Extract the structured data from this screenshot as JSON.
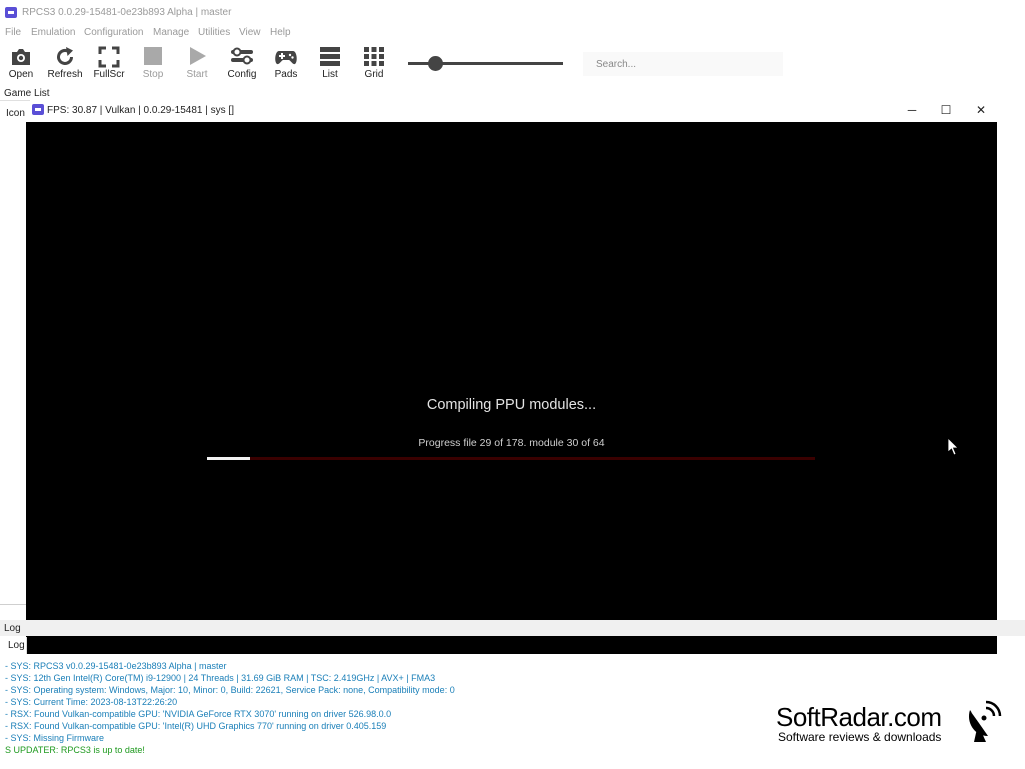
{
  "app": {
    "title": "RPCS3 0.0.29-15481-0e23b893 Alpha | master"
  },
  "menu": [
    "File",
    "Emulation",
    "Configuration",
    "Manage",
    "Utilities",
    "View",
    "Help"
  ],
  "toolbar": {
    "open": "Open",
    "refresh": "Refresh",
    "fullscreen": "FullScr",
    "stop": "Stop",
    "start": "Start",
    "config": "Config",
    "pads": "Pads",
    "list": "List",
    "grid": "Grid",
    "zoom_level": 0.18
  },
  "search": {
    "placeholder": "Search..."
  },
  "game_list": {
    "label": "Game List",
    "column_icon": "Icon"
  },
  "game_window": {
    "title": "FPS: 30.87 | Vulkan | 0.0.29-15481 | sys []",
    "minimize_glyph": "─",
    "maximize_glyph": "☐",
    "close_glyph": "✕",
    "message": "Compiling PPU modules...",
    "progress_text": "Progress  file 29 of 178. module 30 of 64",
    "progress": 0.07
  },
  "log": {
    "dock_label": "Log",
    "tab_label": "Log",
    "lines": [
      {
        "text": "- SYS: RPCS3 v0.0.29-15481-0e23b893 Alpha | master",
        "color": "#1a7fb8"
      },
      {
        "text": "- SYS: 12th Gen Intel(R) Core(TM) i9-12900 | 24 Threads | 31.69 GiB RAM | TSC: 2.419GHz | AVX+ | FMA3",
        "color": "#1a7fb8"
      },
      {
        "text": "- SYS: Operating system: Windows, Major: 10, Minor: 0, Build: 22621, Service Pack: none, Compatibility mode: 0",
        "color": "#1a7fb8"
      },
      {
        "text": "- SYS: Current Time: 2023-08-13T22:26:20",
        "color": "#1a7fb8"
      },
      {
        "text": "- RSX: Found Vulkan-compatible GPU: 'NVIDIA GeForce RTX 3070' running on driver 526.98.0.0",
        "color": "#1a7fb8"
      },
      {
        "text": "- RSX: Found Vulkan-compatible GPU: 'Intel(R) UHD Graphics 770' running on driver 0.405.159",
        "color": "#1a7fb8"
      },
      {
        "text": "- SYS: Missing Firmware",
        "color": "#1a7fb8"
      },
      {
        "text": "S UPDATER: RPCS3 is up to date!",
        "color": "#1f9a1f"
      }
    ]
  },
  "watermark": {
    "name": "SoftRadar.com",
    "tagline": "Software reviews & downloads"
  }
}
